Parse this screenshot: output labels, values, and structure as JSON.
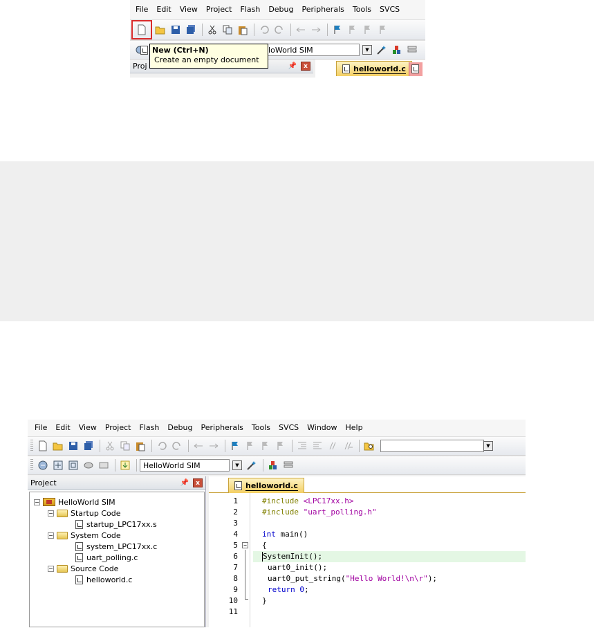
{
  "top_crop": {
    "menu": [
      "File",
      "Edit",
      "View",
      "Project",
      "Flash",
      "Debug",
      "Peripherals",
      "Tools",
      "SVCS"
    ],
    "target_partial": "lloWorld SIM",
    "tooltip_title": "New (Ctrl+N)",
    "tooltip_desc": "Create an empty document",
    "pane_title_partial": "Proj",
    "tab_label": "helloworld.c"
  },
  "bottom": {
    "menu": [
      "File",
      "Edit",
      "View",
      "Project",
      "Flash",
      "Debug",
      "Peripherals",
      "Tools",
      "SVCS",
      "Window",
      "Help"
    ],
    "target": "HelloWorld SIM",
    "pane_title": "Project",
    "tab_label": "helloworld.c",
    "tree": {
      "root": "HelloWorld SIM",
      "groups": [
        {
          "name": "Startup Code",
          "files": [
            "startup_LPC17xx.s"
          ]
        },
        {
          "name": "System Code",
          "files": [
            "system_LPC17xx.c",
            "uart_polling.c"
          ]
        },
        {
          "name": "Source Code",
          "files": [
            "helloworld.c"
          ]
        }
      ]
    },
    "code": {
      "line_numbers": [
        "1",
        "2",
        "3",
        "4",
        "5",
        "6",
        "7",
        "8",
        "9",
        "10",
        "11"
      ],
      "l1a": "#include ",
      "l1b": "<LPC17xx.h>",
      "l2a": "#include ",
      "l2b": "\"uart_polling.h\"",
      "l4a": "int",
      "l4b": " main()",
      "l5": "{",
      "l6": "SystemInit();",
      "l7": "uart0_init();",
      "l8a": "uart0_put_string(",
      "l8b": "\"Hello World!\\n\\r\"",
      "l8c": ");",
      "l9a": "return ",
      "l9b": "0",
      "l9c": ";",
      "l10": "}"
    }
  },
  "colors": {
    "gray_band": "#efefef",
    "highlight_line": "#e4f7e4",
    "new_button_outline": "#d92c2c"
  }
}
